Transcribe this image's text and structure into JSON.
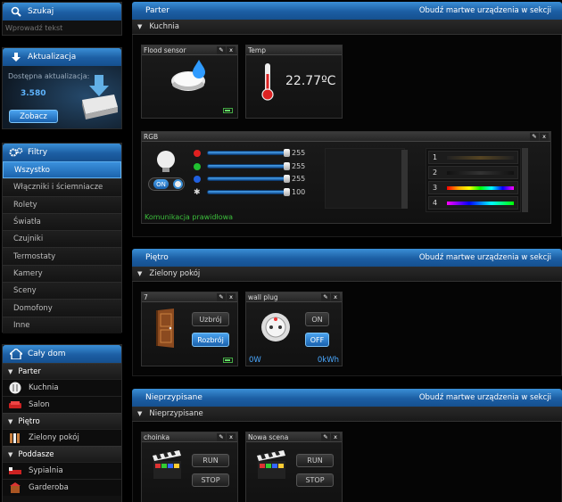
{
  "search": {
    "title": "Szukaj",
    "placeholder": "Wprowadź tekst"
  },
  "update": {
    "title": "Aktualizacja",
    "available_label": "Dostępna aktualizacja:",
    "version": "3.580",
    "show_button": "Zobacz"
  },
  "filters": {
    "title": "Filtry",
    "items": [
      {
        "label": "Wszystko",
        "active": true
      },
      {
        "label": "Włączniki i ściemniacze"
      },
      {
        "label": "Rolety"
      },
      {
        "label": "Światła"
      },
      {
        "label": "Czujniki"
      },
      {
        "label": "Termostaty"
      },
      {
        "label": "Kamery"
      },
      {
        "label": "Sceny"
      },
      {
        "label": "Domofony"
      },
      {
        "label": "Inne"
      }
    ]
  },
  "house": {
    "title": "Cały dom",
    "sections": [
      {
        "label": "Parter",
        "rooms": [
          "Kuchnia",
          "Salon"
        ]
      },
      {
        "label": "Piętro",
        "rooms": [
          "Zielony pokój"
        ]
      },
      {
        "label": "Poddasze",
        "rooms": [
          "Sypialnia",
          "Garderoba"
        ]
      }
    ]
  },
  "main": {
    "wake_label": "Obudź martwe urządzenia w sekcji",
    "parter": {
      "title": "Parter",
      "room": "Kuchnia",
      "flood": {
        "name": "Flood sensor"
      },
      "temp": {
        "name": "Temp",
        "value": "22.77ºC"
      },
      "rgb": {
        "name": "RGB",
        "on_label": "ON",
        "status": "Komunikacja prawidłowa",
        "channels": [
          {
            "color": "#e02020",
            "value": 255,
            "display": "255"
          },
          {
            "color": "#20c030",
            "value": 255,
            "display": "255"
          },
          {
            "color": "#2060e0",
            "value": 255,
            "display": "255"
          },
          {
            "color": "#dddddd",
            "value": 100,
            "display": "100"
          }
        ],
        "programs": [
          "1",
          "2",
          "3",
          "4"
        ]
      }
    },
    "pietro": {
      "title": "Piętro",
      "room": "Zielony pokój",
      "door": {
        "name": "7",
        "arm": "Uzbrój",
        "disarm": "Rozbrój"
      },
      "plug": {
        "name": "wall plug",
        "on": "ON",
        "off": "OFF",
        "power": "0W",
        "energy": "0kWh"
      }
    },
    "unassigned": {
      "title": "Nieprzypisane",
      "room": "Nieprzypisane",
      "scenes": [
        {
          "name": "choinka",
          "run": "RUN",
          "stop": "STOP"
        },
        {
          "name": "Nowa scena",
          "run": "RUN",
          "stop": "STOP"
        }
      ]
    }
  }
}
